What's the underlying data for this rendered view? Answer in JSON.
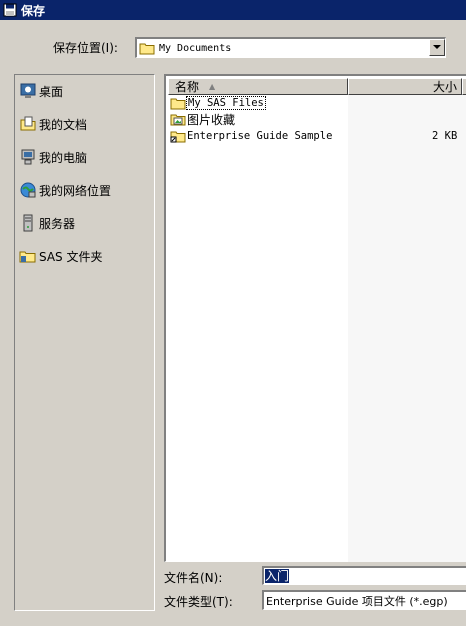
{
  "window": {
    "title": "保存"
  },
  "location": {
    "label": "保存位置(I):",
    "value": "My Documents"
  },
  "places": [
    {
      "label": "桌面",
      "icon": "desktop-icon"
    },
    {
      "label": "我的文档",
      "icon": "my-documents-icon"
    },
    {
      "label": "我的电脑",
      "icon": "my-computer-icon"
    },
    {
      "label": "我的网络位置",
      "icon": "network-places-icon"
    },
    {
      "label": "服务器",
      "icon": "server-icon"
    },
    {
      "label": "SAS 文件夹",
      "icon": "sas-folder-icon"
    }
  ],
  "file_list": {
    "columns": [
      {
        "label": "名称"
      },
      {
        "label": "大小"
      }
    ],
    "rows": [
      {
        "name": "My SAS Files",
        "size": "",
        "icon": "folder-icon"
      },
      {
        "name": "图片收藏",
        "size": "",
        "icon": "pictures-folder-icon"
      },
      {
        "name": "Enterprise Guide Sample",
        "size": "2 KB",
        "icon": "shortcut-folder-icon"
      }
    ]
  },
  "filename": {
    "label": "文件名(N):",
    "value": "入门"
  },
  "filetype": {
    "label": "文件类型(T):",
    "value": "Enterprise Guide 项目文件 (*.egp)"
  },
  "colors": {
    "titlebar": "#0a246a",
    "face": "#d4d0c8",
    "selection": "#0a246a"
  }
}
